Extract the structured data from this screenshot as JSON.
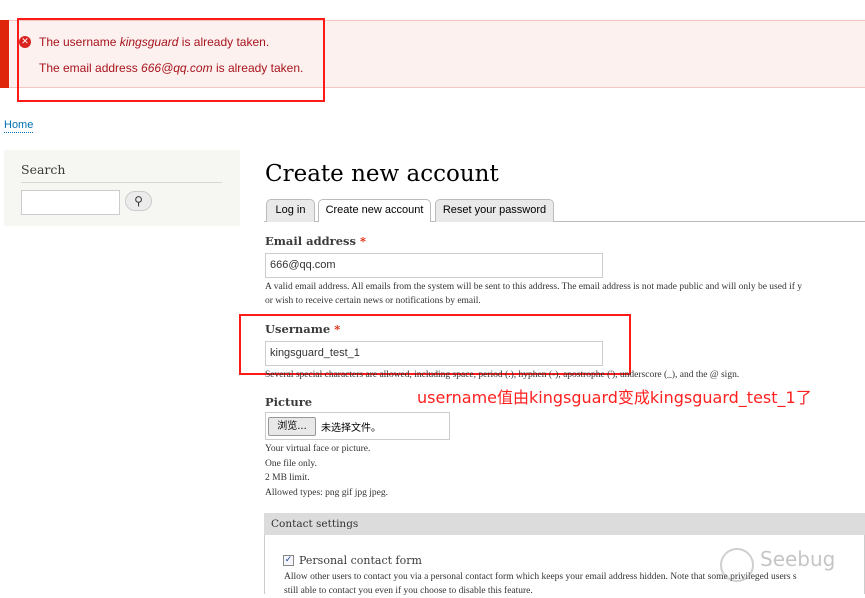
{
  "messages": {
    "error1": {
      "pre": "The username ",
      "em": "kingsguard",
      "post": " is already taken."
    },
    "error2": {
      "pre": "The email address ",
      "em": "666@qq.com",
      "post": " is already taken."
    }
  },
  "breadcrumb": {
    "home": "Home"
  },
  "sidebar": {
    "search_title": "Search",
    "search_value": ""
  },
  "page": {
    "title": "Create new account"
  },
  "tabs": [
    {
      "label": "Log in"
    },
    {
      "label": "Create new account"
    },
    {
      "label": "Reset your password"
    }
  ],
  "form": {
    "email": {
      "label": "Email address",
      "required": "*",
      "value": "666@qq.com",
      "desc1": "A valid email address. All emails from the system will be sent to this address. The email address is not made public and will only be used if y",
      "desc2": "or wish to receive certain news or notifications by email."
    },
    "username": {
      "label": "Username",
      "required": "*",
      "value": "kingsguard_test_1",
      "desc": "Several special characters are allowed, including space, period (.), hyphen (-), apostrophe ('), underscore (_), and the @ sign."
    },
    "picture": {
      "label": "Picture",
      "button": "浏览...",
      "no_file": "未选择文件。",
      "desc": [
        "Your virtual face or picture.",
        "One file only.",
        "2 MB limit.",
        "Allowed types: png gif jpg jpeg."
      ]
    },
    "contact": {
      "legend": "Contact settings",
      "checkbox_label": "Personal contact form",
      "checked": true,
      "desc1": "Allow other users to contact you via a personal contact form which keeps your email address hidden. Note that some privileged users s",
      "desc2": "still able to contact you even if you choose to disable this feature."
    }
  },
  "annotation": "username值由kingsguard变成kingsguard_test_1了",
  "watermark": "Seebug"
}
